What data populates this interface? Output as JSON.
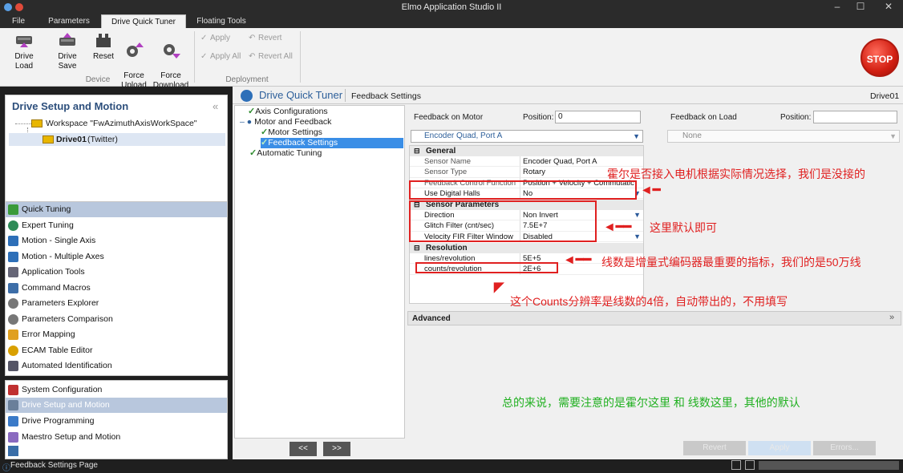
{
  "window": {
    "title": "Elmo Application Studio II"
  },
  "tabs": [
    {
      "label": "File"
    },
    {
      "label": "Parameters"
    },
    {
      "label": "Drive Quick Tuner"
    },
    {
      "label": "Floating Tools"
    }
  ],
  "ribbon": {
    "device_buttons": [
      {
        "label": "Drive Load",
        "icon": "drive-load-icon"
      },
      {
        "label": "Drive Save",
        "icon": "drive-save-icon"
      },
      {
        "label": "Reset",
        "icon": "reset-icon"
      },
      {
        "label": "Force\nUpload",
        "icon": "force-upload-icon"
      },
      {
        "label": "Force\nDownload",
        "icon": "force-download-icon"
      }
    ],
    "device_group": "Device",
    "deployment": {
      "apply": "Apply",
      "revert": "Revert",
      "apply_all": "Apply All",
      "revert_all": "Revert All"
    },
    "deployment_group": "Deployment",
    "stop": "STOP"
  },
  "left": {
    "title": "Drive Setup and Motion",
    "collapse": "«",
    "workspace": "Workspace \"FwAzimuthAxisWorkSpace\"",
    "drive": "Drive01",
    "drive_sub": "(Twitter)",
    "nav1": [
      {
        "label": "Quick Tuning",
        "selected": true
      },
      {
        "label": "Expert Tuning"
      },
      {
        "label": "Motion - Single Axis"
      },
      {
        "label": "Motion - Multiple Axes"
      },
      {
        "label": "Application Tools"
      },
      {
        "label": "Command Macros"
      },
      {
        "label": "Parameters Explorer"
      },
      {
        "label": "Parameters Comparison"
      },
      {
        "label": "Error Mapping"
      },
      {
        "label": "ECAM Table Editor"
      },
      {
        "label": "Automated Identification"
      }
    ],
    "nav2": [
      {
        "label": "System Configuration"
      },
      {
        "label": "Drive Setup and Motion",
        "selected": true
      },
      {
        "label": "Drive Programming"
      },
      {
        "label": "Maestro Setup and Motion"
      }
    ]
  },
  "center": {
    "header": "Drive Quick Tuner",
    "breadcrumb": "Feedback Settings",
    "drive": "Drive01",
    "tree": [
      {
        "label": "Axis Configurations",
        "check": true
      },
      {
        "label": "Motor and Feedback",
        "bullet": true
      },
      {
        "label": "Motor Settings",
        "check": true
      },
      {
        "label": "Feedback Settings",
        "check": true,
        "selected": true
      },
      {
        "label": "Automatic Tuning",
        "check": true
      }
    ],
    "nav_prev": "<<",
    "nav_next": ">>",
    "fb_motor": {
      "label": "Feedback on Motor",
      "position_label": "Position:",
      "position_value": "0",
      "sensor_select": "Encoder Quad, Port A"
    },
    "fb_load": {
      "label": "Feedback on Load",
      "position_label": "Position:",
      "position_value": "",
      "sensor_select": "None"
    },
    "sections": {
      "general": {
        "title": "General",
        "rows": [
          {
            "name": "Sensor Name",
            "value": "Encoder Quad, Port A"
          },
          {
            "name": "Sensor Type",
            "value": "Rotary"
          },
          {
            "name": "Feedback Control Function",
            "value": "Position + Velocity + Commutatic"
          },
          {
            "name": "Use Digital Halls",
            "value": "No",
            "dropdown": true
          }
        ]
      },
      "sensor": {
        "title": "Sensor Parameters",
        "rows": [
          {
            "name": "Direction",
            "value": "Non Invert",
            "dropdown": true
          },
          {
            "name": "Glitch Filter (cnt/sec)",
            "value": "7.5E+7"
          },
          {
            "name": "Velocity FIR Filter Window",
            "value": "Disabled",
            "dropdown": true
          }
        ]
      },
      "resolution": {
        "title": "Resolution",
        "rows": [
          {
            "name": "lines/revolution",
            "value": "5E+5"
          },
          {
            "name": "counts/revolution",
            "value": "2E+6"
          }
        ]
      }
    },
    "advanced": "Advanced",
    "buttons": {
      "revert": "Revert",
      "apply": "Apply",
      "errors": "Errors..."
    }
  },
  "annotations": {
    "halls": "霍尔是否接入电机根据实际情况选择，我们是没接的",
    "default": "这里默认即可",
    "lines": "线数是增量式编码器最重要的指标，我们的是50万线",
    "counts": "这个Counts分辨率是线数的4倍，自动带出的，不用填写",
    "summary": "总的来说，需要注意的是霍尔这里 和 线数这里，其他的默认"
  },
  "status": {
    "text": "Feedback Settings Page"
  }
}
